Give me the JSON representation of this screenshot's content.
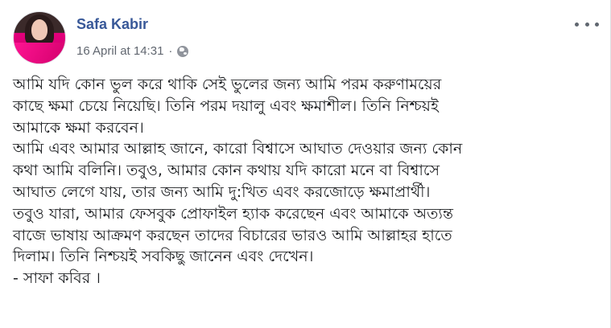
{
  "post": {
    "author": "Safa Kabir",
    "timestamp": "16 April at 14:31",
    "audience_icon": "globe-icon",
    "more_icon": "more-options-icon",
    "lines": [
      "আমি যদি কোন ভুল করে থাকি সেই ভুলের জন্য আমি পরম করুণাময়ের",
      "কাছে ক্ষমা চেয়ে নিয়েছি। তিনি পরম দয়ালু এবং ক্ষমাশীল। তিনি নিশ্চয়ই",
      "আমাকে ক্ষমা করবেন।",
      "আমি এবং আমার আল্লাহ জানে, কারো বিশ্বাসে আঘাত দেওয়ার জন্য কোন",
      "কথা আমি বলিনি। তবুও, আমার কোন কথায় যদি কারো মনে বা বিশ্বাসে",
      "আঘাত লেগে যায়, তার জন্য আমি দু:খিত এবং করজোড়ে ক্ষমাপ্রার্থী।",
      "তবুও যারা, আমার ফেসবুক প্রোফাইল হ্যাক করেছেন এবং আমাকে অত্যন্ত",
      "বাজে ভাষায় আক্রমণ করছেন তাদের বিচারের ভারও আমি আল্লাহর হাতে",
      "দিলাম। তিনি নিশ্চয়ই সবকিছু জানেন এবং দেখেন।",
      "- সাফা কবির ।"
    ]
  },
  "colors": {
    "author": "#385898",
    "meta": "#616770",
    "text": "#1c1e21"
  }
}
